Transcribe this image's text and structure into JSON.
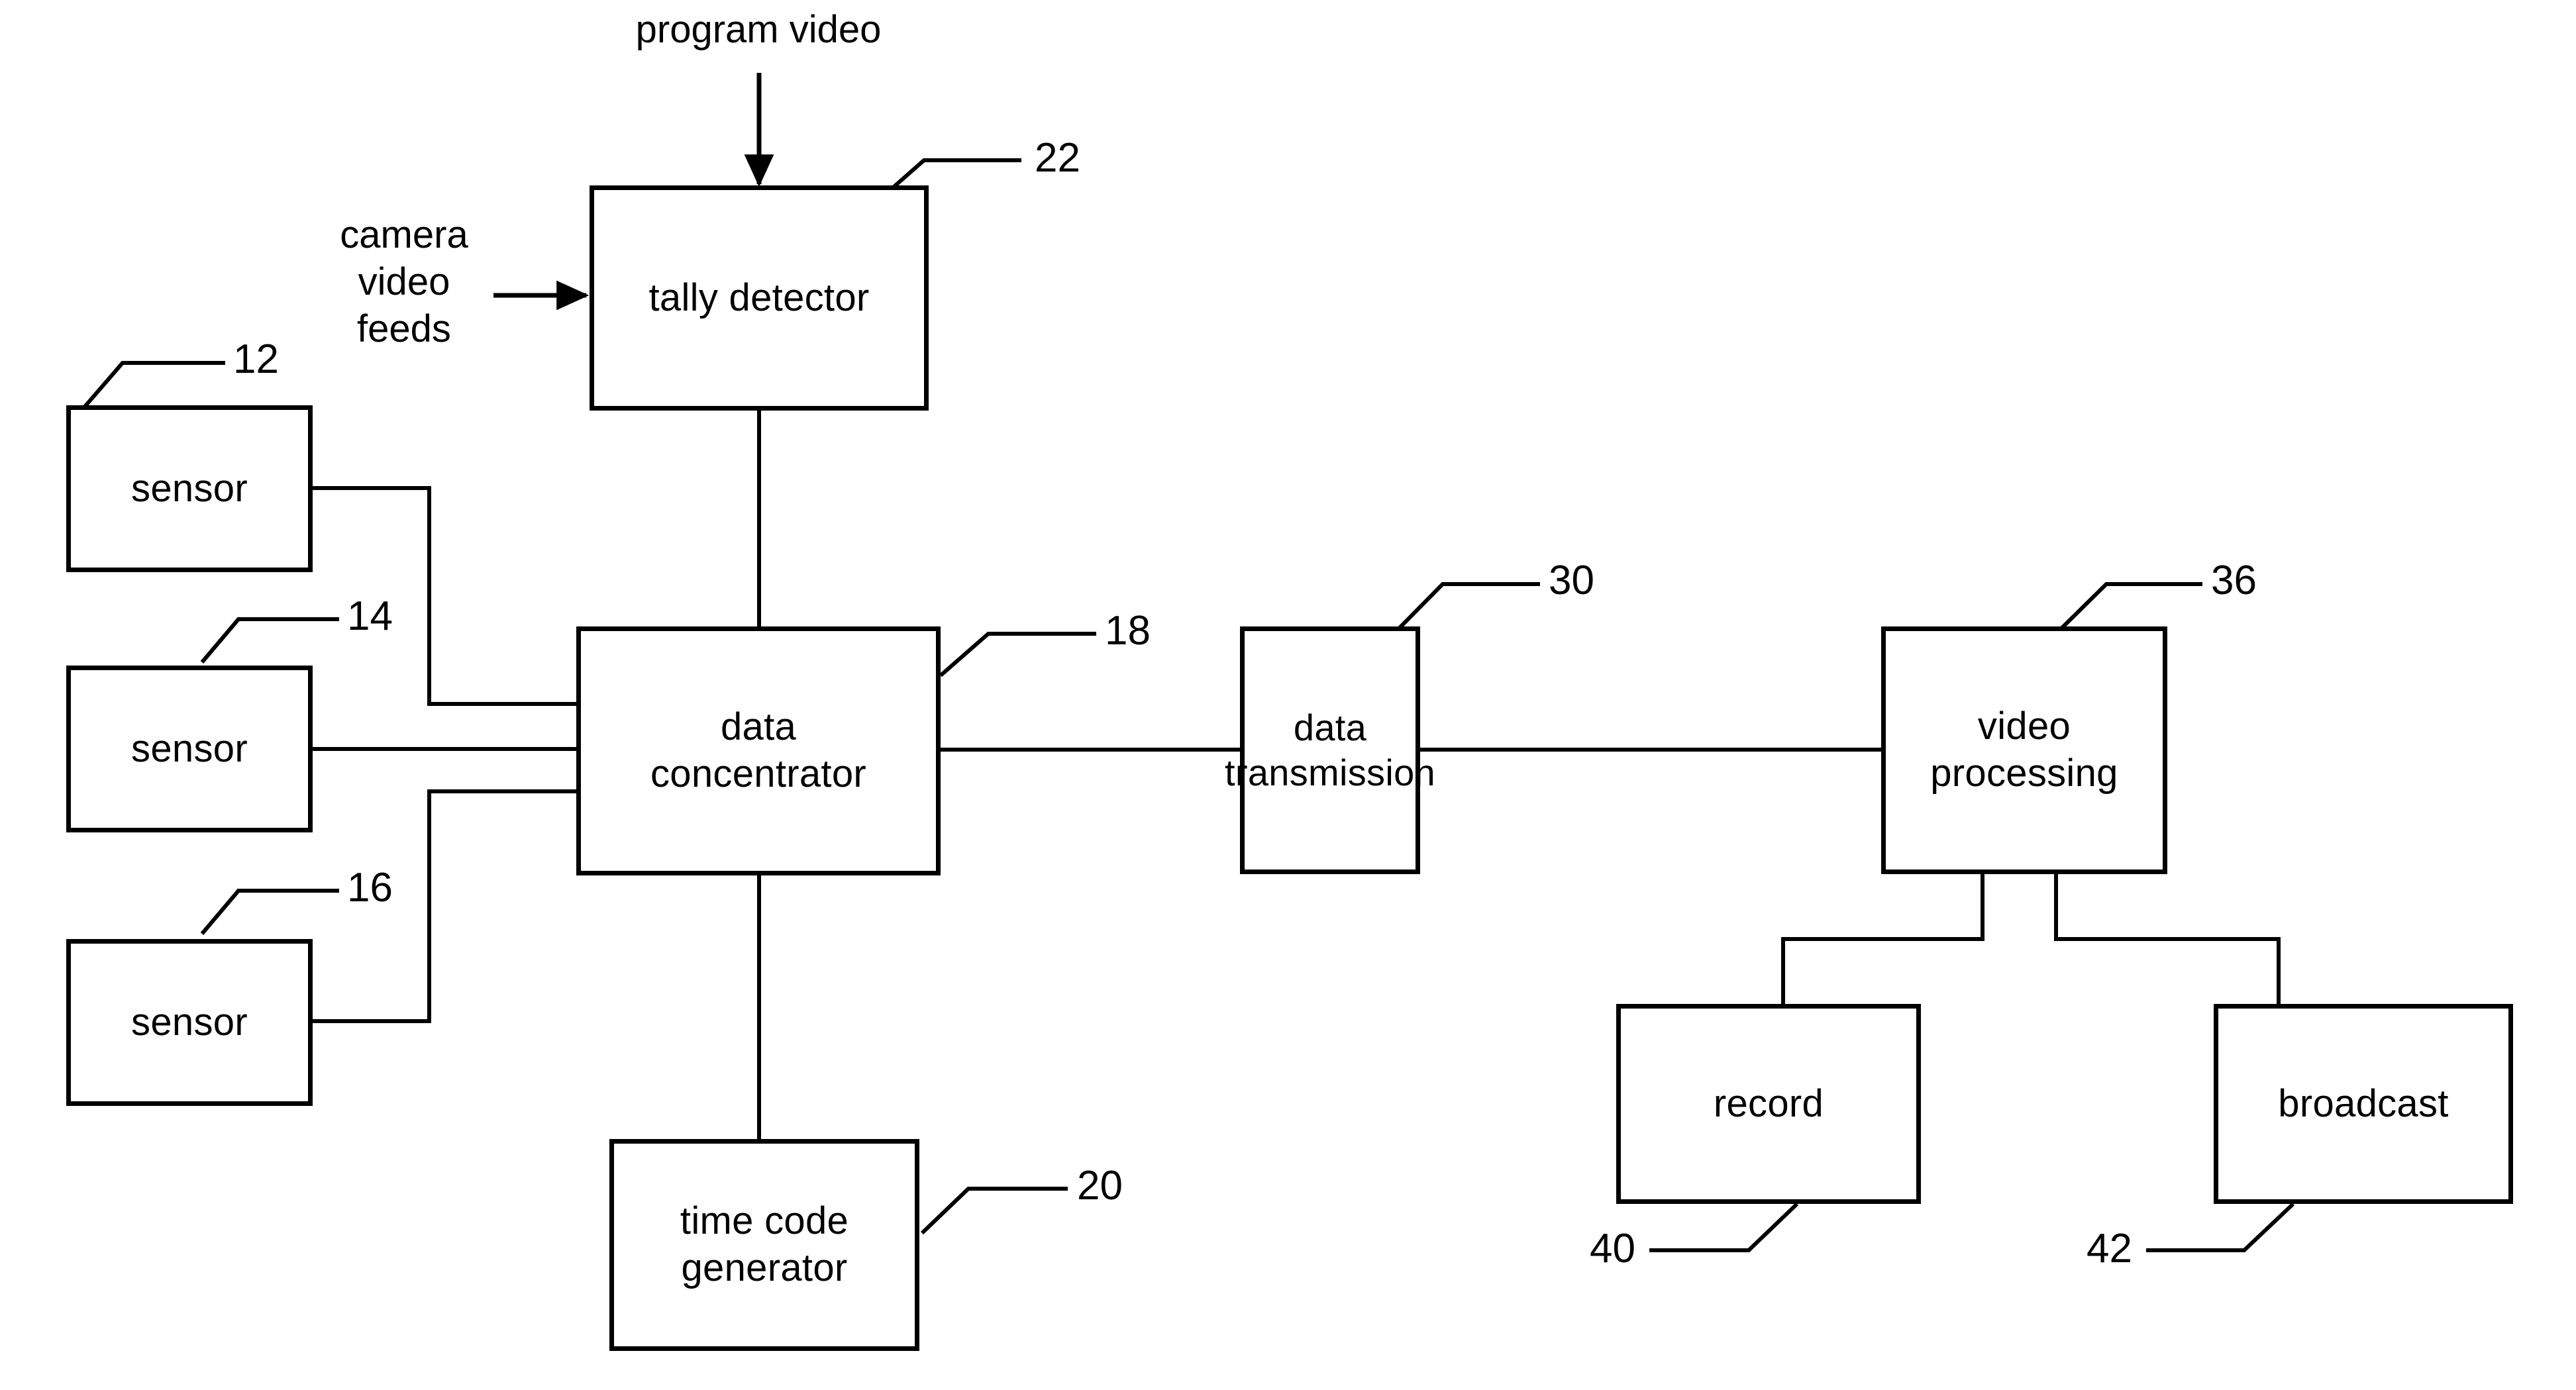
{
  "figure": {
    "type": "patent-block-diagram",
    "background_color": "#ffffff",
    "line_color": "#000000"
  },
  "flow_labels": {
    "program_video": "program video",
    "camera_video_feeds": "camera\nvideo\nfeeds"
  },
  "blocks": {
    "sensor_12": {
      "label": "sensor",
      "ref": "12"
    },
    "sensor_14": {
      "label": "sensor",
      "ref": "14"
    },
    "sensor_16": {
      "label": "sensor",
      "ref": "16"
    },
    "tally_detector": {
      "label": "tally detector",
      "ref": "22"
    },
    "data_concentrator": {
      "label": "data\nconcentrator",
      "ref": "18"
    },
    "time_code_generator": {
      "label": "time code\ngenerator",
      "ref": "20"
    },
    "data_transmission": {
      "label": "data\ntransmission",
      "ref": "30"
    },
    "video_processing": {
      "label": "video\nprocessing",
      "ref": "36"
    },
    "record": {
      "label": "record",
      "ref": "40"
    },
    "broadcast": {
      "label": "broadcast",
      "ref": "42"
    }
  },
  "reference_numerals": {
    "n12": "12",
    "n14": "14",
    "n16": "16",
    "n18": "18",
    "n20": "20",
    "n22": "22",
    "n30": "30",
    "n36": "36",
    "n40": "40",
    "n42": "42"
  }
}
